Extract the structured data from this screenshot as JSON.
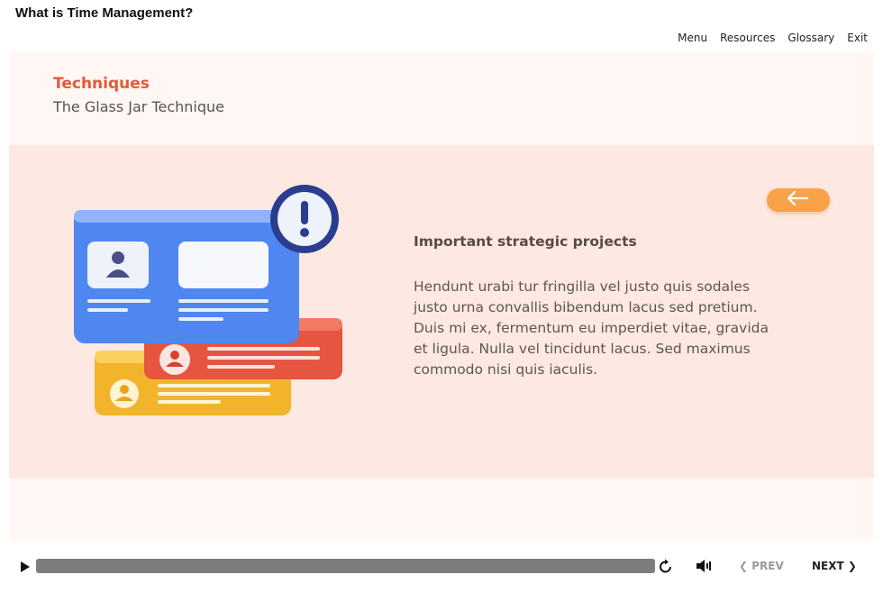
{
  "header": {
    "course_title": "What is Time Management?"
  },
  "topnav": {
    "menu": "Menu",
    "resources": "Resources",
    "glossary": "Glossary",
    "exit": "Exit"
  },
  "slide": {
    "section_title": "Techniques",
    "section_subtitle": "The Glass Jar Technique",
    "heading": "Important strategic projects",
    "body": "Hendunt urabi tur fringilla vel justo quis sodales justo urna convallis bibendum lacus sed pretium. Duis mi ex, fermentum eu imperdiet vitae, gravida et ligula. Nulla vel tincidunt lacus. Sed maximus commodo nisi quis iaculis.",
    "back_button_icon": "arrow-left-icon",
    "illustration": "profile-cards-alert-illustration"
  },
  "player": {
    "prev_label": "PREV",
    "next_label": "NEXT",
    "progress": 1.0,
    "icons": [
      "play-icon",
      "replay-icon",
      "volume-icon",
      "chevron-left-icon",
      "chevron-right-icon"
    ]
  },
  "colors": {
    "accent": "#e05a38",
    "back_button": "#f8a24a",
    "panel_bg": "#fde9e2",
    "stage_bg": "#fff7f4",
    "progress": "#7d7d7d"
  }
}
